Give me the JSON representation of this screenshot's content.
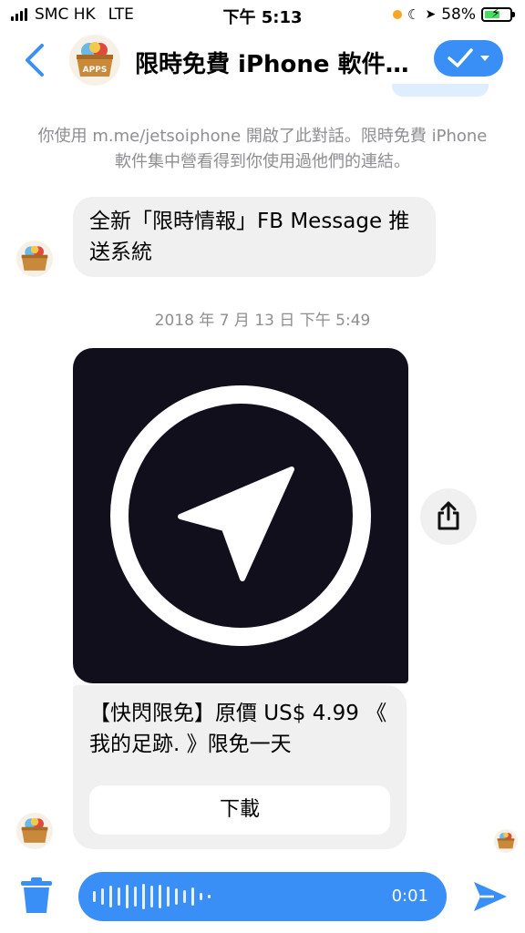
{
  "status_bar": {
    "carrier": "SMC HK",
    "network": "LTE",
    "time": "下午 5:13",
    "battery": "58%"
  },
  "header": {
    "title": "限時免費 iPhone 軟件集中營",
    "avatar_label": "APPS",
    "accent_color": "#3a8ff7"
  },
  "conversation": {
    "info_text": "你使用 m.me/jetsoiphone 開啟了此對話。限時免費 iPhone 軟件集中營看得到你使用過他們的連結。",
    "message_1": "全新「限時情報」FB Message 推送系統",
    "timestamp": "2018 年 7 月 13 日 下午 5:49",
    "card": {
      "text": "【快閃限免】原價 US$ 4.99 《 我的足跡. 》限免一天",
      "button_label": "下載",
      "image_background": "#110f1c"
    }
  },
  "composer": {
    "voice_duration": "0:01"
  },
  "icons": [
    "back-chevron-icon",
    "checkmark-icon",
    "share-icon",
    "trash-icon",
    "send-icon",
    "navigation-arrow-icon"
  ]
}
